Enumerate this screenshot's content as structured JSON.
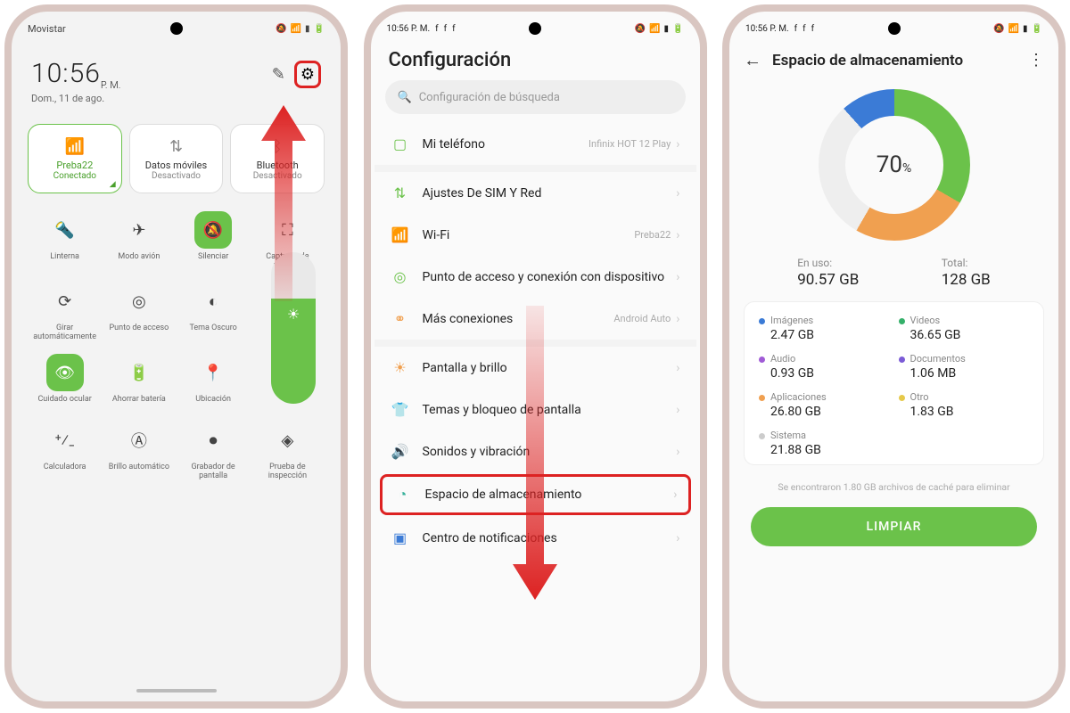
{
  "screen1": {
    "carrier": "Movistar",
    "time": "10:56",
    "ampm": "P. M.",
    "date": "Dom., 11 de ago.",
    "conn": {
      "wifi": {
        "name": "Preba22",
        "status": "Conectado"
      },
      "data": {
        "name": "Datos móviles",
        "status": "Desactivado"
      },
      "bt": {
        "name": "Bluetooth",
        "status": "Desactivado"
      }
    },
    "tiles": {
      "flash": "Linterna",
      "airplane": "Modo avión",
      "silence": "Silenciar",
      "screenshot": "Capturas de pantalla",
      "rotate": "Girar automáticamente",
      "hotspot": "Punto de acceso",
      "dark": "Tema Oscuro",
      "eye": "Cuidado ocular",
      "battery": "Ahorrar batería",
      "location": "Ubicación",
      "calc": "Calculadora",
      "autobright": "Brillo automático",
      "record": "Grabador de pantalla",
      "inspect": "Prueba de inspección"
    }
  },
  "screen2": {
    "status_time": "10:56 P. M.",
    "title": "Configuración",
    "search_placeholder": "Configuración de búsqueda",
    "items": {
      "myphone": {
        "label": "Mi teléfono",
        "sub": "Infinix HOT 12 Play"
      },
      "sim": {
        "label": "Ajustes De SIM Y Red"
      },
      "wifi": {
        "label": "Wi-Fi",
        "sub": "Preba22"
      },
      "hotspot": {
        "label": "Punto de acceso y conexión con dispositivo"
      },
      "moreconn": {
        "label": "Más conexiones",
        "sub": "Android Auto"
      },
      "display": {
        "label": "Pantalla y brillo"
      },
      "themes": {
        "label": "Temas y bloqueo de pantalla"
      },
      "sound": {
        "label": "Sonidos y vibración"
      },
      "storage": {
        "label": "Espacio de almacenamiento"
      },
      "notif": {
        "label": "Centro de notificaciones"
      }
    }
  },
  "screen3": {
    "status_time": "10:56 P. M.",
    "title": "Espacio de almacenamiento",
    "percent": "70",
    "percent_suffix": "%",
    "used_label": "En uso:",
    "used_value": "90.57 GB",
    "total_label": "Total:",
    "total_value": "128 GB",
    "categories": {
      "images": {
        "label": "Imágenes",
        "value": "2.47 GB",
        "color": "#3b7bd6"
      },
      "videos": {
        "label": "Videos",
        "value": "36.65 GB",
        "color": "#35b06a"
      },
      "audio": {
        "label": "Audio",
        "value": "0.93 GB",
        "color": "#a05bd6"
      },
      "docs": {
        "label": "Documentos",
        "value": "1.06 MB",
        "color": "#7b5bd6"
      },
      "apps": {
        "label": "Aplicaciones",
        "value": "26.80 GB",
        "color": "#f0a050"
      },
      "other": {
        "label": "Otro",
        "value": "1.83 GB",
        "color": "#e6c94a"
      },
      "system": {
        "label": "Sistema",
        "value": "21.88 GB",
        "color": "#ccc"
      }
    },
    "cache_note": "Se encontraron 1.80 GB archivos de caché para eliminar",
    "clean_button": "LIMPIAR"
  }
}
